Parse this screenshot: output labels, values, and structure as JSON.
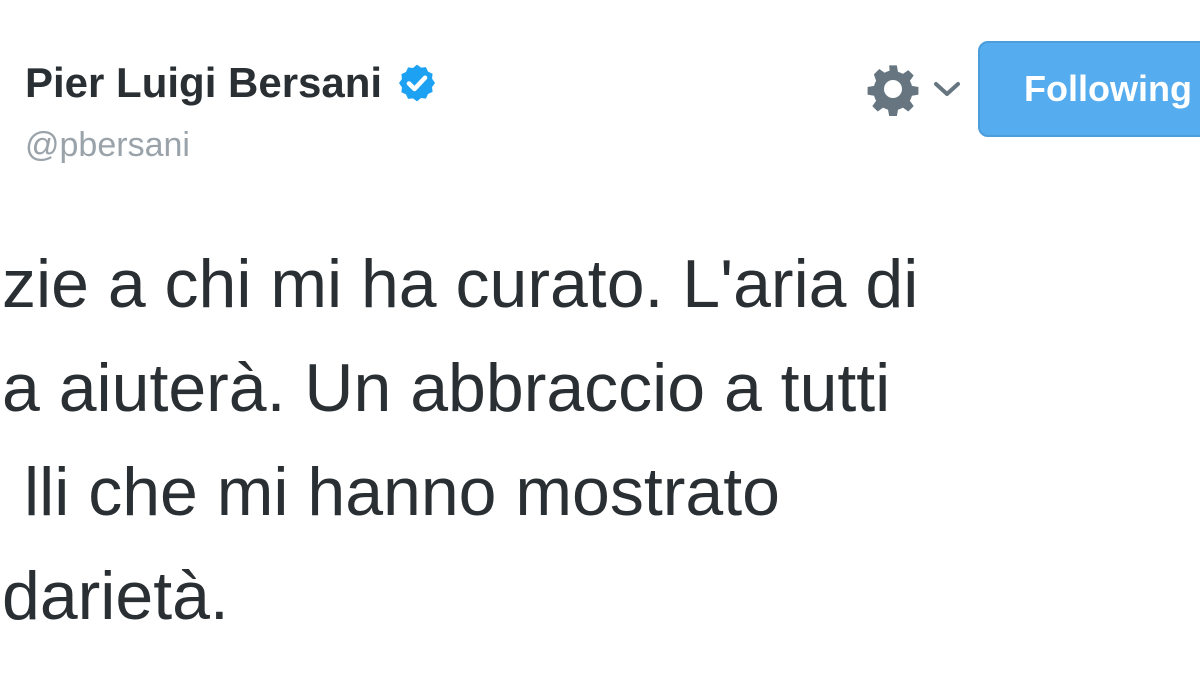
{
  "header": {
    "display_name": "Pier Luigi Bersani",
    "handle": "@pbersani",
    "follow_button_label": "Following"
  },
  "icons": {
    "verified": "verified-badge-icon",
    "settings": "gear-icon",
    "dropdown": "chevron-down-icon"
  },
  "tweet": {
    "lines": [
      "zie a chi mi ha curato. L'aria di",
      "a aiuterà. Un abbraccio a tutti",
      "lli che mi hanno mostrato",
      "darietà."
    ]
  },
  "colors": {
    "accent": "#55acee",
    "verified": "#1da1f2",
    "text": "#292f33",
    "muted": "#9aa3aa",
    "icon": "#66757f"
  }
}
